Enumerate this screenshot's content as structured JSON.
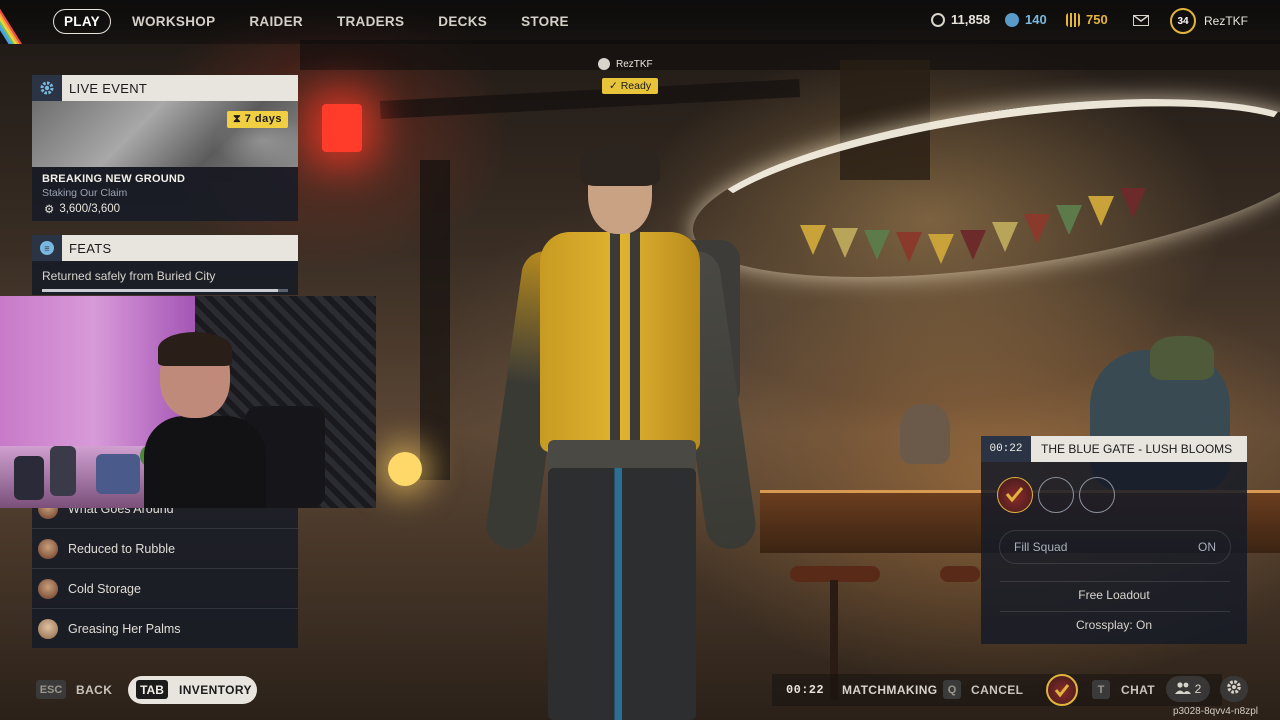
{
  "nav": {
    "items": [
      "PLAY",
      "WORKSHOP",
      "RAIDER",
      "TRADERS",
      "DECKS",
      "STORE"
    ]
  },
  "currencies": [
    {
      "icon": "coin-icon",
      "value": "11,858",
      "color": "#d8d4cc"
    },
    {
      "icon": "credit-icon",
      "value": "140",
      "color": "#6bb0d8"
    },
    {
      "icon": "token-icon",
      "value": "750",
      "color": "#e6b63a"
    }
  ],
  "profile": {
    "level": "34",
    "username": "RezTKF"
  },
  "live_event": {
    "header": "LIVE EVENT",
    "days": "7 days",
    "title": "BREAKING NEW GROUND",
    "subtitle": "Staking Our Claim",
    "progress": "3,600/3,600",
    "progress_fraction": 1.0
  },
  "feats": {
    "header": "FEATS",
    "current": "Returned safely from Buried City",
    "progress_fraction": 0.96
  },
  "quest_list": [
    {
      "label": "What Goes Around"
    },
    {
      "label": "Reduced to Rubble"
    },
    {
      "label": "Cold Storage"
    },
    {
      "label": "Greasing Her Palms"
    }
  ],
  "player_tag": {
    "name": "RezTKF",
    "status": "Ready"
  },
  "matchmaking": {
    "timer": "00:22",
    "map": "THE BLUE GATE - LUSH BLOOMS",
    "fill_squad_label": "Fill Squad",
    "fill_squad_value": "ON",
    "loadout": "Free Loadout",
    "crossplay": "Crossplay: On"
  },
  "bottom": {
    "back_key": "ESC",
    "back_label": "BACK",
    "inventory_key": "TAB",
    "inventory_label": "INVENTORY",
    "timer": "00:22",
    "matchmaking_label": "MATCHMAKING",
    "cancel_key": "Q",
    "cancel_label": "CANCEL",
    "chat_key": "T",
    "chat_label": "CHAT",
    "friends_count": "2"
  },
  "watermark": "p3028-8qvv4-n8zpl"
}
